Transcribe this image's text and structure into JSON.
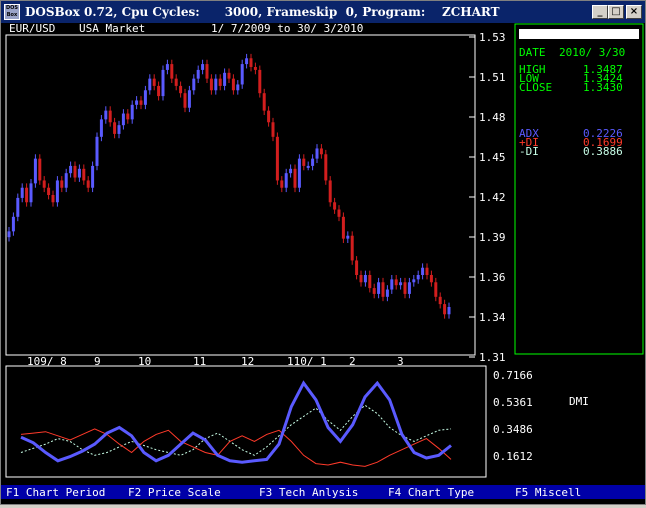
{
  "window": {
    "title": "DOSBox 0.72, Cpu Cycles:      3000, Frameskip  0, Program:    ZCHART",
    "icon_label": "DOS Box",
    "minimize_glyph": "_",
    "maximize_glyph": "□",
    "close_glyph": "×"
  },
  "chart": {
    "symbol": "EUR/USD",
    "market": "USA Market",
    "date_range": "1/ 7/2009 to 30/ 3/2010",
    "price_axis": [
      "1.53",
      "1.51",
      "1.48",
      "1.45",
      "1.42",
      "1.39",
      "1.36",
      "1.34",
      "1.31"
    ],
    "time_axis": [
      "109/ 8",
      "9",
      "10",
      "11",
      "12",
      "110/ 1",
      "2",
      "3"
    ],
    "indicator_axis": [
      "0.7166",
      "0.5361",
      "0.3486",
      "0.1612"
    ],
    "indicator_label": "DMI"
  },
  "info_panel": {
    "date_label": "DATE",
    "date_value": "2010/ 3/30",
    "high_label": "HIGH",
    "high_value": "1.3487",
    "low_label": "LOW",
    "low_value": "1.3424",
    "close_label": "CLOSE",
    "close_value": "1.3430",
    "adx_label": "ADX",
    "adx_value": "0.2226",
    "pdi_label": "+DI",
    "pdi_value": "0.1699",
    "mdi_label": "-DI",
    "mdi_value": "0.3886"
  },
  "function_keys": [
    {
      "key": "F1",
      "label": "Chart Period"
    },
    {
      "key": "F2",
      "label": "Price Scale"
    },
    {
      "key": "F3",
      "label": "Tech Anlysis"
    },
    {
      "key": "F4",
      "label": "Chart Type"
    },
    {
      "key": "F5",
      "label": "Miscell"
    }
  ],
  "colors": {
    "bg": "#000000",
    "text": "#ffffff",
    "panel_text": "#00ff00",
    "up_candle": "#5a5aff",
    "down_candle": "#d21e1e",
    "adx": "#5a5aff",
    "pdi": "#ff3a2a",
    "mdi": "#c8ffe8",
    "fkey_bar": "#0000a8"
  },
  "chart_data": {
    "type": "candlestick",
    "ylim": [
      1.31,
      1.53
    ],
    "close_series": [
      1.395,
      1.405,
      1.418,
      1.425,
      1.415,
      1.428,
      1.445,
      1.43,
      1.425,
      1.42,
      1.415,
      1.43,
      1.425,
      1.435,
      1.44,
      1.432,
      1.438,
      1.43,
      1.425,
      1.44,
      1.46,
      1.472,
      1.478,
      1.47,
      1.462,
      1.468,
      1.476,
      1.472,
      1.482,
      1.485,
      1.482,
      1.492,
      1.5,
      1.495,
      1.488,
      1.506,
      1.51,
      1.5,
      1.495,
      1.49,
      1.48,
      1.492,
      1.5,
      1.506,
      1.51,
      1.5,
      1.492,
      1.5,
      1.495,
      1.504,
      1.5,
      1.492,
      1.496,
      1.51,
      1.514,
      1.508,
      1.506,
      1.49,
      1.478,
      1.47,
      1.46,
      1.43,
      1.425,
      1.435,
      1.438,
      1.425,
      1.445,
      1.44,
      1.44,
      1.445,
      1.452,
      1.448,
      1.43,
      1.415,
      1.41,
      1.405,
      1.39,
      1.392,
      1.375,
      1.365,
      1.36,
      1.365,
      1.356,
      1.352,
      1.36,
      1.35,
      1.355,
      1.362,
      1.358,
      1.36,
      1.352,
      1.36,
      1.362,
      1.365,
      1.37,
      1.365,
      1.36,
      1.35,
      1.345,
      1.338,
      1.343
    ],
    "adx": [
      0.33,
      0.29,
      0.22,
      0.16,
      0.19,
      0.23,
      0.28,
      0.36,
      0.4,
      0.34,
      0.22,
      0.16,
      0.2,
      0.28,
      0.36,
      0.31,
      0.2,
      0.16,
      0.15,
      0.16,
      0.17,
      0.28,
      0.55,
      0.72,
      0.6,
      0.4,
      0.3,
      0.42,
      0.62,
      0.72,
      0.6,
      0.35,
      0.22,
      0.18,
      0.2,
      0.27
    ],
    "plus_di": [
      0.35,
      0.36,
      0.37,
      0.34,
      0.31,
      0.35,
      0.39,
      0.35,
      0.28,
      0.22,
      0.3,
      0.35,
      0.38,
      0.3,
      0.26,
      0.22,
      0.2,
      0.3,
      0.34,
      0.3,
      0.35,
      0.38,
      0.3,
      0.2,
      0.14,
      0.13,
      0.15,
      0.13,
      0.12,
      0.15,
      0.2,
      0.24,
      0.28,
      0.32,
      0.25,
      0.17
    ],
    "minus_di": [
      0.22,
      0.25,
      0.28,
      0.32,
      0.3,
      0.24,
      0.2,
      0.22,
      0.26,
      0.3,
      0.27,
      0.24,
      0.22,
      0.2,
      0.24,
      0.32,
      0.36,
      0.3,
      0.24,
      0.2,
      0.26,
      0.34,
      0.42,
      0.48,
      0.54,
      0.45,
      0.38,
      0.48,
      0.56,
      0.5,
      0.4,
      0.34,
      0.3,
      0.34,
      0.38,
      0.39
    ]
  }
}
